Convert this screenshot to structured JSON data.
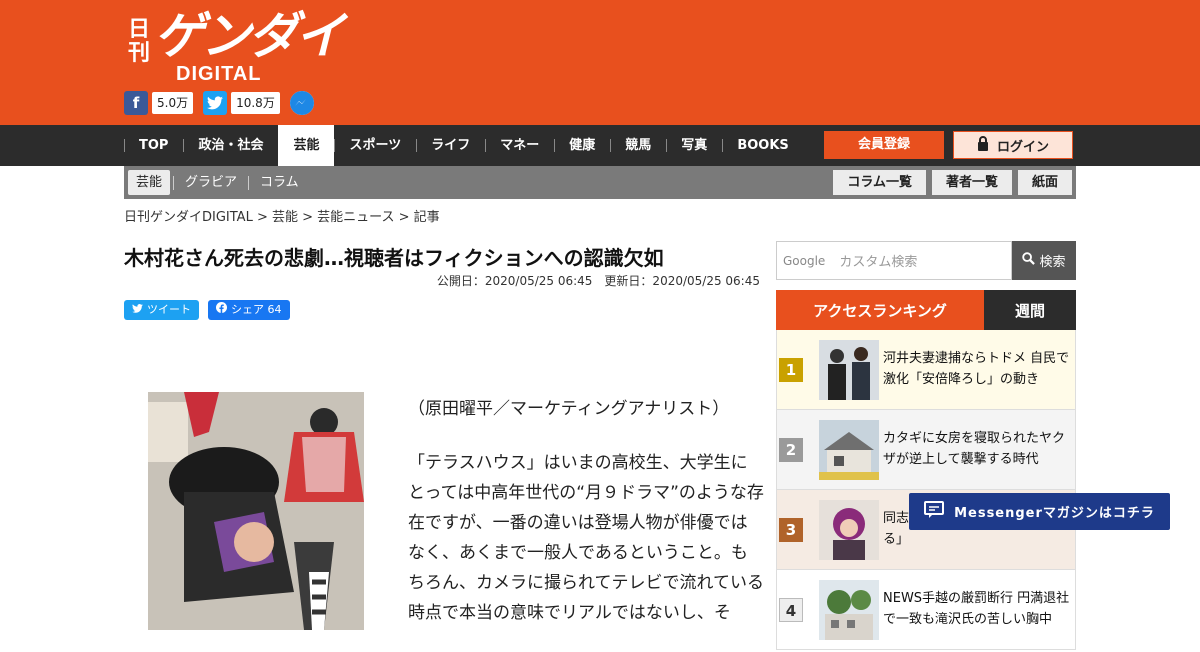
{
  "header": {
    "logo_small": "日刊",
    "logo_main": "ゲンダイ",
    "logo_sub": "DIGITAL",
    "brand_color": "#e8501e"
  },
  "social": {
    "facebook_count": "5.0万",
    "twitter_count": "10.8万",
    "icons": [
      "facebook-icon",
      "twitter-icon",
      "messenger-icon"
    ]
  },
  "nav": {
    "items": [
      {
        "label": "TOP"
      },
      {
        "label": "政治・社会"
      },
      {
        "label": "芸能",
        "active": true
      },
      {
        "label": "スポーツ"
      },
      {
        "label": "ライフ"
      },
      {
        "label": "マネー"
      },
      {
        "label": "健康"
      },
      {
        "label": "競馬"
      },
      {
        "label": "写真"
      },
      {
        "label": "BOOKS"
      }
    ],
    "register_label": "会員登録",
    "login_label": "ログイン"
  },
  "subnav": {
    "tabs": [
      {
        "label": "芸能",
        "active": true
      },
      {
        "label": "グラビア"
      },
      {
        "label": "コラム"
      }
    ],
    "buttons": [
      "コラム一覧",
      "著者一覧",
      "紙面"
    ]
  },
  "breadcrumb": "日刊ゲンダイDIGITAL > 芸能 > 芸能ニュース > 記事",
  "article": {
    "title": "木村花さん死去の悲劇…視聴者はフィクションへの認識欠如",
    "dates": "公開日：2020/05/25 06:45　更新日：2020/05/25 06:45",
    "tweet_label": "ツイート",
    "share_label": "シェア 64",
    "paragraphs": [
      "（原田曜平／マーケティングアナリスト）",
      "「テラスハウス」はいまの高校生、大学生にとっては中高年世代の“月９ドラマ”のような存在ですが、一番の違いは登場人物が俳優ではなく、あくまで一般人であるということ。もちろん、カメラに撮られてテレビで流れている時点で本当の意味でリアルではないし、そ"
    ]
  },
  "search": {
    "google_label": "Google",
    "placeholder": "カスタム検索",
    "button_label": "検索"
  },
  "ranking": {
    "tab_access": "アクセスランキング",
    "tab_weekly": "週間",
    "items": [
      {
        "rank": "1",
        "text": "河井夫妻逮捕ならトドメ 自民で激化「安倍降ろし」の動き"
      },
      {
        "rank": "2",
        "text": "カタギに女房を寝取られたヤクザが逆上して襲撃する時代"
      },
      {
        "rank": "3",
        "text": "同志 脱して超に入って共生する」"
      },
      {
        "rank": "4",
        "text": "NEWS手越の厳罰断行 円満退社で一致も滝沢氏の苦しい胸中"
      }
    ]
  },
  "messenger": {
    "label": "Messengerマガジンはコチラ"
  }
}
